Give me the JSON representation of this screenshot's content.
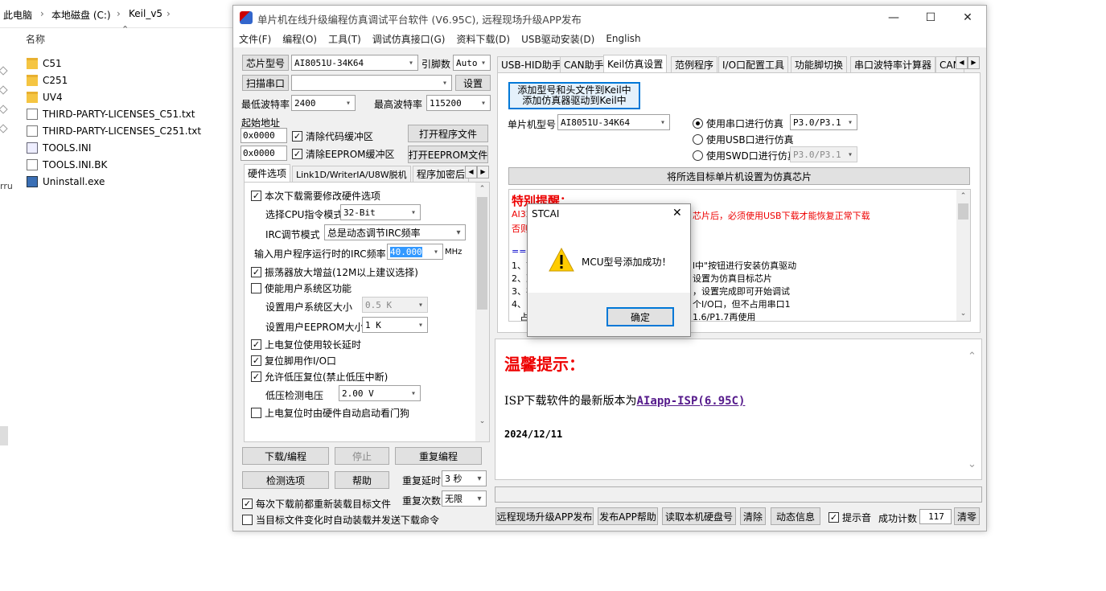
{
  "explorer": {
    "breadcrumb": [
      "此电脑",
      "本地磁盘 (C:)",
      "Keil_v5"
    ],
    "sep": "›",
    "col_header": "名称",
    "files": [
      {
        "name": "C51",
        "type": "folder"
      },
      {
        "name": "C251",
        "type": "folder"
      },
      {
        "name": "UV4",
        "type": "folder"
      },
      {
        "name": "THIRD-PARTY-LICENSES_C51.txt",
        "type": "text"
      },
      {
        "name": "THIRD-PARTY-LICENSES_C251.txt",
        "type": "text"
      },
      {
        "name": "TOOLS.INI",
        "type": "ini"
      },
      {
        "name": "TOOLS.INI.BK",
        "type": "text"
      },
      {
        "name": "Uninstall.exe",
        "type": "exe"
      }
    ],
    "left_stub": "rru"
  },
  "window": {
    "title": "单片机在线升级编程仿真调试平台软件 (V6.95C), 远程现场升级APP发布",
    "controls": {
      "minimize": "—",
      "maximize": "☐",
      "close": "✕"
    },
    "menu": [
      "文件(F)",
      "编程(O)",
      "工具(T)",
      "调试仿真接口(G)",
      "资料下载(D)",
      "USB驱动安装(D)",
      "English"
    ]
  },
  "left": {
    "chip_label": "芯片型号",
    "chip_value": "AI8051U-34K64",
    "pins_label": "引脚数",
    "pins_value": "Auto",
    "scan_label": "扫描串口",
    "port_value": "",
    "settings_label": "设置",
    "min_baud_label": "最低波特率",
    "min_baud": "2400",
    "max_baud_label": "最高波特率",
    "max_baud": "115200",
    "start_addr_label": "起始地址",
    "addr1": "0x0000",
    "addr2": "0x0000",
    "clear_code": "清除代码缓冲区",
    "clear_eeprom": "清除EEPROM缓冲区",
    "open_prog": "打开程序文件",
    "open_eeprom": "打开EEPROM文件",
    "tabs": [
      "硬件选项",
      "Link1D/WriterIA/U8W脱机",
      "程序加密后"
    ],
    "hw": {
      "opt1": "本次下载需要修改硬件选项",
      "cpu_label": "选择CPU指令模式",
      "cpu_value": "32-Bit",
      "irc_label": "IRC调节模式",
      "irc_value": "总是动态调节IRC频率",
      "freq_label": "输入用户程序运行时的IRC频率",
      "freq_value": "40.000",
      "freq_unit": "MHz",
      "osc": "振荡器放大增益(12M以上建议选择)",
      "usr_sys": "使能用户系统区功能",
      "usr_sys_size_label": "设置用户系统区大小",
      "usr_sys_size": "0.5 K",
      "eeprom_size_label": "设置用户EEPROM大小",
      "eeprom_size": "1  K",
      "por_delay": "上电复位使用较长延时",
      "reset_io": "复位脚用作I/O口",
      "lvr": "允许低压复位(禁止低压中断)",
      "lvd_label": "低压检测电压",
      "lvd_value": "2.00 V",
      "wdt": "上电复位时由硬件自动启动看门狗"
    },
    "download": "下载/编程",
    "stop": "停止",
    "repeat_prog": "重复编程",
    "check_opts": "检测选项",
    "help": "帮助",
    "repeat_delay_label": "重复延时",
    "repeat_delay": "3 秒",
    "repeat_count_label": "重复次数",
    "repeat_count": "无限",
    "reload_each": "每次下载前都重新装载目标文件",
    "auto_reload": "当目标文件变化时自动装载并发送下载命令"
  },
  "right": {
    "tabs": [
      "USB-HID助手",
      "CAN助手",
      "Keil仿真设置",
      "范例程序",
      "I/O口配置工具",
      "功能脚切换",
      "串口波特率计算器",
      "CAN"
    ],
    "keil": {
      "add_btn_line1": "添加型号和头文件到Keil中",
      "add_btn_line2": "添加仿真器驱动到Keil中",
      "mcu_label": "单片机型号",
      "mcu_value": "AI8051U-34K64",
      "radio_serial": "使用串口进行仿真",
      "serial_port": "P3.0/P3.1",
      "radio_usb": "使用USB口进行仿真",
      "radio_swd": "使用SWD口进行仿真",
      "swd_port": "P3.0/P3.1",
      "set_chip": "将所选目标单片机设置为仿真芯片",
      "notice_title": "特别提醒：",
      "notice_red1_a": "AI32",
      "notice_red1_b": "芯片后，必须使用USB下载才能恢复正常下载",
      "notice_red2": "否则",
      "arrow": "==>",
      "l1a": "1、首",
      "l1b": "l中\"按钮进行安装仿真驱动",
      "l2a": "2、准",
      "l2b": "设置为仿真目标芯片",
      "l3a": "3、在",
      "l3b": "，设置完成即可开始调试",
      "l4a": "4、串",
      "l4b": "个I/O口，但不占用串口1",
      "l5a": "   占",
      "l5b": "1.6/P1.7再使用"
    },
    "tip_title": "温馨提示：",
    "tip_line": "ISP下载软件的最新版本为",
    "tip_link": "AIapp-ISP(6.95C)",
    "tip_date": "2024/12/11",
    "bottom": {
      "remote": "远程现场升级APP发布",
      "publish_help": "发布APP帮助",
      "read_disk": "读取本机硬盘号",
      "clear": "清除",
      "dyn_info": "动态信息",
      "beep": "提示音",
      "count_label": "成功计数",
      "count": "117",
      "reset": "清零"
    }
  },
  "dialog": {
    "title": "STCAI",
    "close": "✕",
    "message": "MCU型号添加成功！",
    "ok": "确定"
  }
}
